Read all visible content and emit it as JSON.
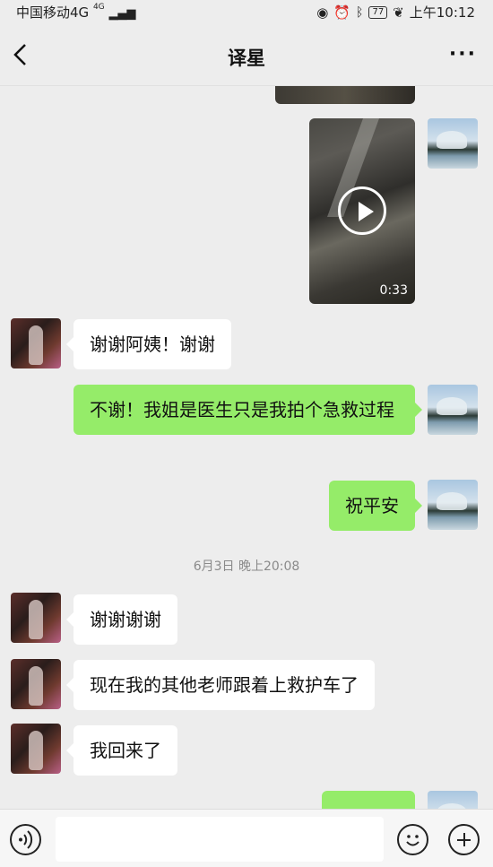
{
  "status_bar": {
    "carrier": "中国移动4G",
    "signal_label": "4G",
    "battery": "77",
    "time": "上午10:12"
  },
  "header": {
    "title": "译星",
    "more_label": "···"
  },
  "chat": {
    "video": {
      "duration": "0:33"
    },
    "messages": [
      {
        "from": "other",
        "text": "谢谢阿姨！谢谢"
      },
      {
        "from": "self",
        "text": "不谢！我姐是医生只是我拍个急救过程"
      },
      {
        "from": "self",
        "text": "祝平安"
      },
      {
        "from": "other",
        "text": "谢谢谢谢"
      },
      {
        "from": "other",
        "text": "现在我的其他老师跟着上救护车了"
      },
      {
        "from": "other",
        "text": "我回来了"
      }
    ],
    "timestamp": "6月3日 晚上20:08"
  },
  "input_bar": {
    "placeholder": ""
  },
  "colors": {
    "background": "#ededed",
    "bubble_self": "#95ec69",
    "bubble_other": "#ffffff"
  },
  "icons": [
    "back-arrow-icon",
    "more-icon",
    "play-icon",
    "voice-icon",
    "emoji-icon",
    "plus-icon",
    "eye-icon",
    "alarm-icon",
    "bluetooth-icon",
    "battery-icon",
    "leaf-icon"
  ]
}
